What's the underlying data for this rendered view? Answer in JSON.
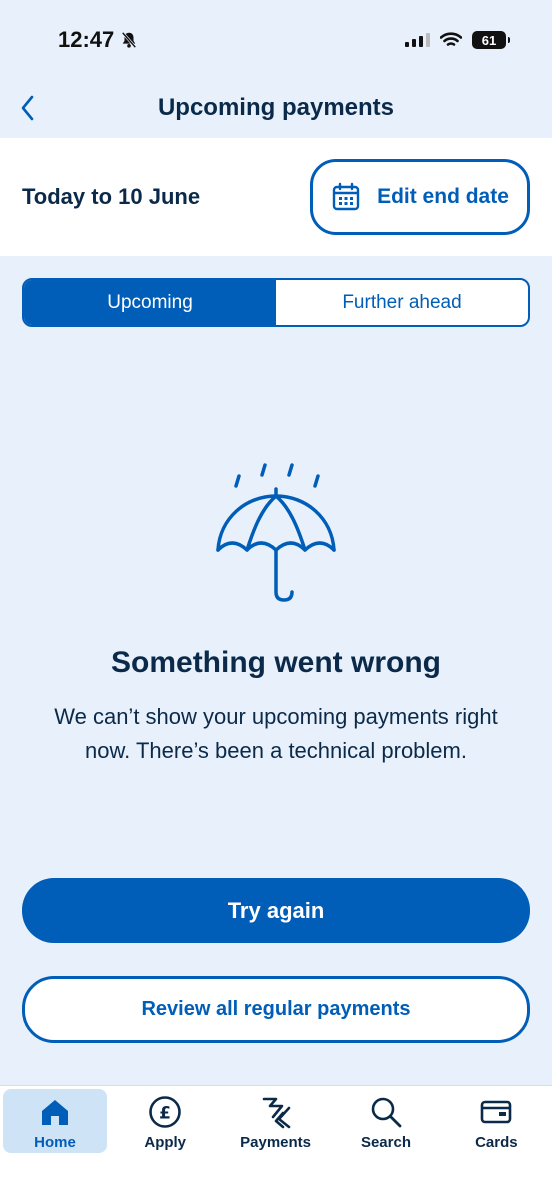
{
  "status_bar": {
    "time": "12:47",
    "battery": "61"
  },
  "header": {
    "title": "Upcoming payments",
    "back_icon": "chevron-left-icon"
  },
  "date_bar": {
    "range": "Today to 10 June",
    "edit_button": "Edit end date",
    "edit_icon": "calendar-icon"
  },
  "tabs": [
    {
      "label": "Upcoming",
      "active": true
    },
    {
      "label": "Further ahead",
      "active": false
    }
  ],
  "error": {
    "icon": "umbrella-rain-icon",
    "title": "Something went wrong",
    "body": "We can’t show your upcoming payments right now. There’s been a technical problem."
  },
  "actions": {
    "retry": "Try again",
    "review": "Review all regular payments"
  },
  "bottom_nav": [
    {
      "label": "Home",
      "icon": "home-icon",
      "active": true
    },
    {
      "label": "Apply",
      "icon": "pound-icon",
      "active": false
    },
    {
      "label": "Payments",
      "icon": "payments-arrows-icon",
      "active": false
    },
    {
      "label": "Search",
      "icon": "search-icon",
      "active": false
    },
    {
      "label": "Cards",
      "icon": "card-icon",
      "active": false
    }
  ],
  "colors": {
    "primary": "#005eb8",
    "background": "#e8f1fb",
    "text": "#0b2a4a",
    "active_tab_bg": "#cfe3f7"
  }
}
